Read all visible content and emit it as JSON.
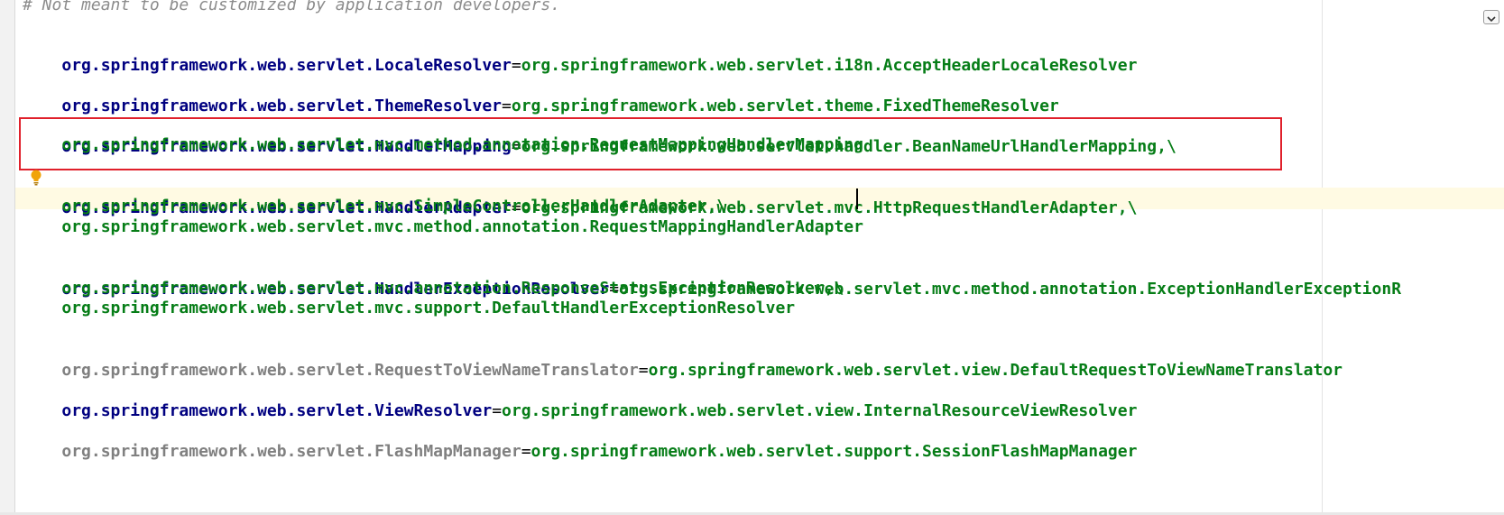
{
  "editor": {
    "lines": {
      "comment": "# Not meant to be customized by application developers.",
      "locale_key": "org.springframework.web.servlet.LocaleResolver",
      "locale_eq": "=",
      "locale_value": "org.springframework.web.servlet.i18n.AcceptHeaderLocaleResolver",
      "theme_key": "org.springframework.web.servlet.ThemeResolver",
      "theme_eq": "=",
      "theme_value": "org.springframework.web.servlet.theme.FixedThemeResolver",
      "mapping_key": "org.springframework.web.servlet.HandlerMapping",
      "mapping_eq": "=",
      "mapping_value_1": "org.springframework.web.servlet.handler.BeanNameUrlHandlerMapping,\\",
      "mapping_value_2": "    org.springframework.web.servlet.mvc.method.annotation.RequestMappingHandlerMapping",
      "adapter_key": "org.springframework.web.servlet.HandlerAdapter",
      "adapter_eq": "=",
      "adapter_value_1": "org.springframework.web.servlet.mvc.HttpRequestHandlerAdapter,\\",
      "adapter_value_2": "    org.springframework.web.servlet.mvc.SimpleControllerHandlerAdapter,\\",
      "adapter_value_3": "    org.springframework.web.servlet.mvc.method.annotation.RequestMappingHandlerAdapter",
      "exception_key": "org.springframework.web.servlet.HandlerExceptionResolver",
      "exception_eq": "=",
      "exception_value_1": "org.springframework.web.servlet.mvc.method.annotation.ExceptionHandlerExceptionR",
      "exception_value_2": "    org.springframework.web.servlet.mvc.annotation.ResponseStatusExceptionResolver,\\",
      "exception_value_3": "    org.springframework.web.servlet.mvc.support.DefaultHandlerExceptionResolver",
      "translator_key": "org.springframework.web.servlet.RequestToViewNameTranslator",
      "translator_eq": "=",
      "translator_value": "org.springframework.web.servlet.view.DefaultRequestToViewNameTranslator",
      "view_key": "org.springframework.web.servlet.ViewResolver",
      "view_eq": "=",
      "view_value": "org.springframework.web.servlet.view.InternalResourceViewResolver",
      "flash_key": "org.springframework.web.servlet.FlashMapManager",
      "flash_eq": "=",
      "flash_value": "org.springframework.web.servlet.support.SessionFlashMapManager"
    }
  },
  "colors": {
    "key": "#000080",
    "key_unused": "#808080",
    "value": "#067d17",
    "highlight_box": "#e0202b",
    "caret_row": "#fffae3",
    "intention_bulb": "#f0a30a"
  },
  "icons": {
    "intention": "lightbulb-icon",
    "dropdown": "chevron-down-icon"
  }
}
